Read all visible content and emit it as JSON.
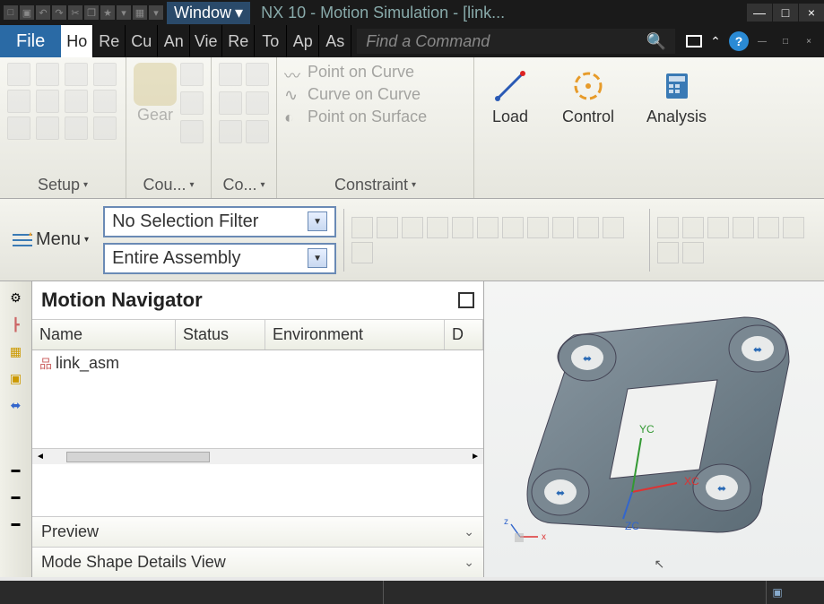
{
  "titlebar": {
    "dropdown_label": "Window",
    "app_title": "NX 10 - Motion Simulation - [link..."
  },
  "menubar": {
    "file": "File",
    "tabs": [
      "Ho",
      "Re",
      "Cu",
      "An",
      "Vie",
      "Re",
      "To",
      "Ap",
      "As"
    ],
    "search_placeholder": "Find a Command"
  },
  "ribbon": {
    "setup_label": "Setup",
    "gear_label": "Gear",
    "couple_label": "Cou...",
    "connector_label": "Co...",
    "constraint": {
      "label": "Constraint",
      "point_on_curve": "Point on Curve",
      "curve_on_curve": "Curve on Curve",
      "point_on_surface": "Point on Surface"
    },
    "load_label": "Load",
    "control_label": "Control",
    "analysis_label": "Analysis"
  },
  "filterbar": {
    "menu_label": "Menu",
    "selection_filter": "No Selection Filter",
    "assembly_filter": "Entire Assembly"
  },
  "navigator": {
    "title": "Motion Navigator",
    "columns": {
      "name": "Name",
      "status": "Status",
      "environment": "Environment",
      "d": "D"
    },
    "rows": [
      {
        "name": "link_asm"
      }
    ],
    "preview_label": "Preview",
    "mode_shape_label": "Mode Shape Details View"
  },
  "viewport": {
    "axes": {
      "x": "XC",
      "y": "YC",
      "z": "ZC"
    },
    "mini_axes": {
      "x": "x",
      "z": "z"
    }
  }
}
